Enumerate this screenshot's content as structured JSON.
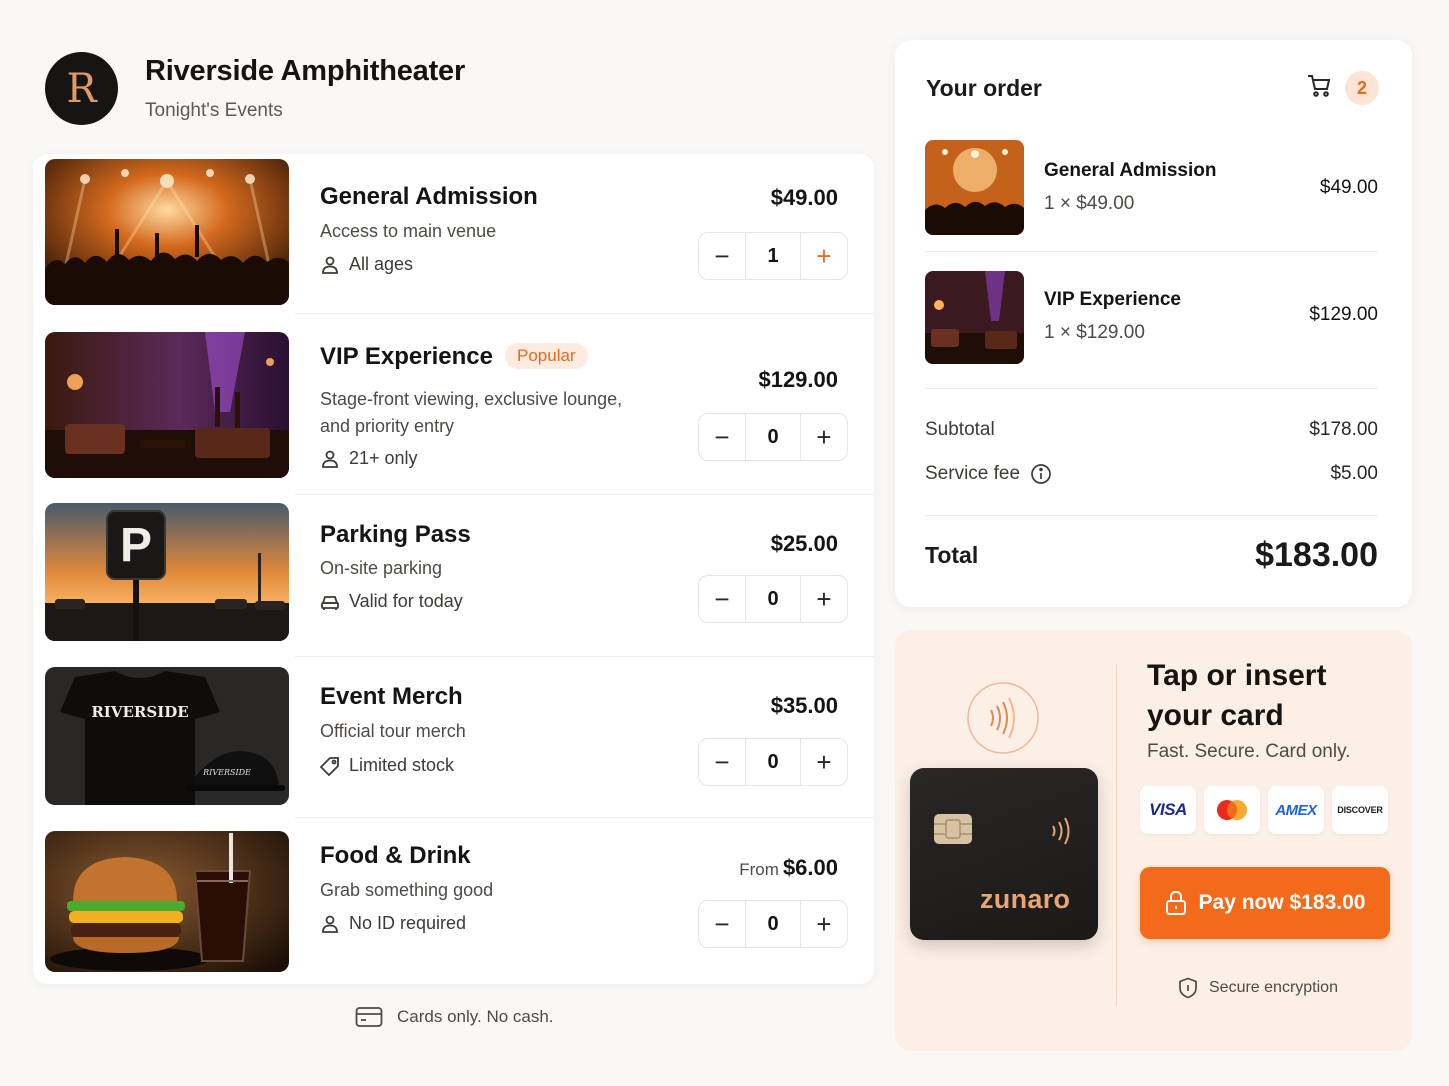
{
  "venue": {
    "logo_letter": "R",
    "name": "Riverside Amphitheater",
    "subtitle": "Tonight's Events"
  },
  "tickets": [
    {
      "name": "General Admission",
      "desc": "Access to main venue",
      "meta": "All ages",
      "meta_icon": "person-icon",
      "price": "$49.00",
      "qty": "1",
      "badge": ""
    },
    {
      "name": "VIP Experience",
      "badge": "Popular",
      "desc_line1": "Stage-front viewing, exclusive lounge,",
      "desc_line2": "and priority entry",
      "meta": "21+ only",
      "meta_icon": "person-icon",
      "price": "$129.00",
      "qty": "0"
    },
    {
      "name": "Parking Pass",
      "desc": "On-site parking",
      "meta": "Valid for today",
      "meta_icon": "car-icon",
      "price": "$25.00",
      "qty": "0",
      "badge": ""
    },
    {
      "name": "Event Merch",
      "desc": "Official tour merch",
      "meta": "Limited stock",
      "meta_icon": "tag-icon",
      "price": "$35.00",
      "qty": "0",
      "badge": "",
      "shirt_text": "RIVERSIDE",
      "cap_text": "RIVERSIDE"
    },
    {
      "name": "Food & Drink",
      "desc": "Grab something good",
      "meta": "No ID required",
      "meta_icon": "person-icon",
      "price_prefix": "From",
      "price": "$6.00",
      "qty": "0",
      "badge": ""
    }
  ],
  "cards_note": "Cards only. No cash.",
  "order": {
    "title": "Your order",
    "cart_count": "2",
    "items": [
      {
        "name": "General Admission",
        "qty_line": "1 × $49.00",
        "price": "$49.00"
      },
      {
        "name": "VIP Experience",
        "qty_line": "1 × $129.00",
        "price": "$129.00"
      }
    ],
    "subtotal_label": "Subtotal",
    "subtotal": "$178.00",
    "fee_label": "Service fee",
    "fee": "$5.00",
    "total_label": "Total",
    "total": "$183.00"
  },
  "payment": {
    "card_brand": "zunaro",
    "title_line1": "Tap or insert",
    "title_line2": "your card",
    "subtitle": "Fast. Secure. Card only.",
    "logos": [
      "VISA",
      "mastercard",
      "AMEX",
      "DISCOVER"
    ],
    "pay_button": "Pay now $183.00",
    "secure_note": "Secure encryption"
  },
  "colors": {
    "accent": "#f26a1a",
    "badge_bg": "#fdebe0",
    "pay_panel_bg": "#fcefe6",
    "card_brand": "#e8a472"
  }
}
